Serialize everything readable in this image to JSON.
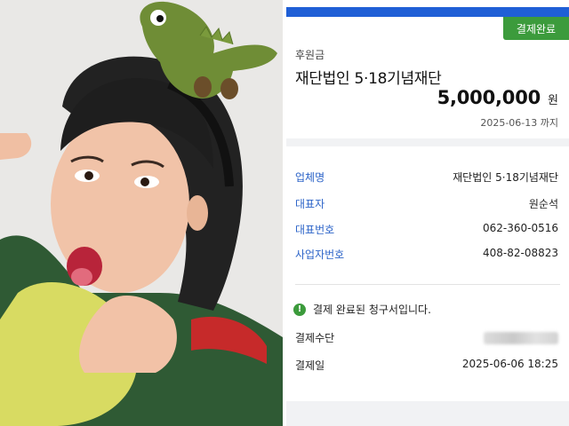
{
  "receipt": {
    "badge": "결제완료",
    "section_label": "후원금",
    "org_title": "재단법인 5·18기념재단",
    "amount": "5,000,000",
    "currency": "원",
    "due_date": "2025-06-13 까지",
    "fields": [
      {
        "key": "업체명",
        "value": "재단법인 5·18기념재단"
      },
      {
        "key": "대표자",
        "value": "원순석"
      },
      {
        "key": "대표번호",
        "value": "062-360-0516"
      },
      {
        "key": "사업자번호",
        "value": "408-82-08823"
      }
    ],
    "notice": "결제 완료된 청구서입니다.",
    "notice_icon": "exclamation-icon",
    "payment": [
      {
        "key": "결제수단",
        "value": ""
      },
      {
        "key": "결제일",
        "value": "2025-06-06 18:25"
      }
    ],
    "colors": {
      "topbar": "#1f5fd6",
      "badge": "#3c9b3c",
      "field_key": "#2b63c8"
    }
  }
}
